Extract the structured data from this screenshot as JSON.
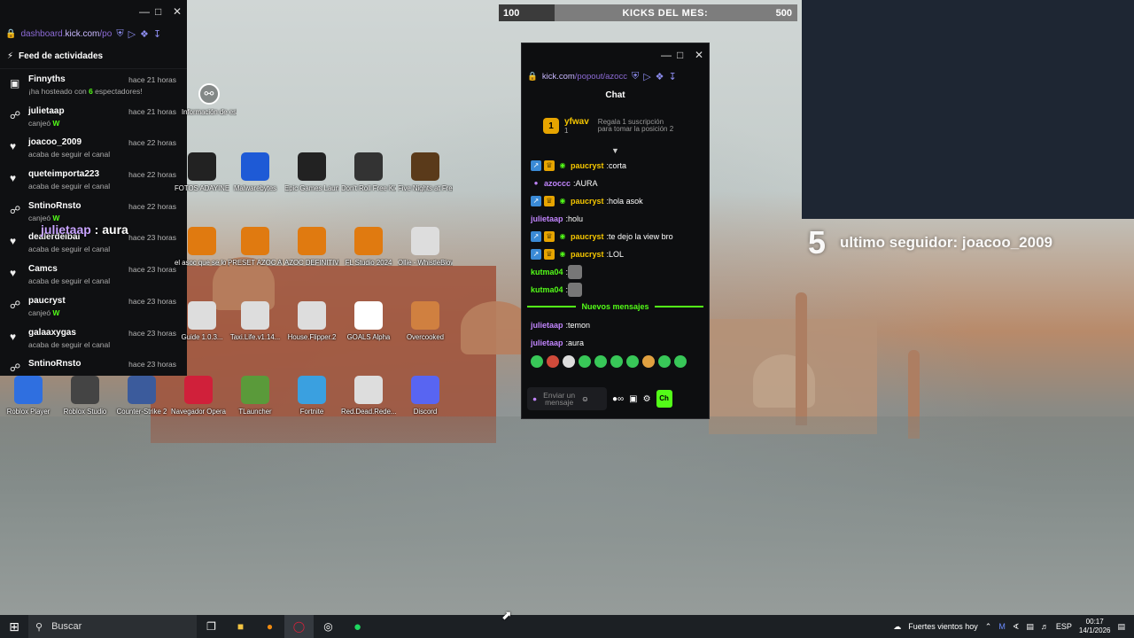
{
  "feed": {
    "url_prefix": "dashboard.",
    "url_domain": "kick.com",
    "url_path": "/po",
    "header": "Feed de actividades",
    "items": [
      {
        "icon": "stream-icon",
        "name": "Finnyths",
        "time": "hace 21 horas",
        "desc_pre": "¡ha hosteado con ",
        "desc_num": "6",
        "desc_post": " espectadores!"
      },
      {
        "icon": "share-icon",
        "name": "julietaap",
        "time": "hace 21 horas",
        "desc_pre": "canjeó ",
        "desc_num": "W",
        "desc_post": ""
      },
      {
        "icon": "heart-icon",
        "name": "joacoo_2009",
        "time": "hace 22 horas",
        "desc_pre": "acaba de seguir el canal",
        "desc_num": "",
        "desc_post": ""
      },
      {
        "icon": "heart-icon",
        "name": "queteimporta223",
        "time": "hace 22 horas",
        "desc_pre": "acaba de seguir el canal",
        "desc_num": "",
        "desc_post": ""
      },
      {
        "icon": "share-icon",
        "name": "SntinoRnsto",
        "time": "hace 22 horas",
        "desc_pre": "canjeó ",
        "desc_num": "W",
        "desc_post": ""
      },
      {
        "icon": "heart-icon",
        "name": "dealerdeibai",
        "time": "hace 23 horas",
        "desc_pre": "acaba de seguir el canal",
        "desc_num": "",
        "desc_post": ""
      },
      {
        "icon": "heart-icon",
        "name": "Camcs",
        "time": "hace 23 horas",
        "desc_pre": "acaba de seguir el canal",
        "desc_num": "",
        "desc_post": ""
      },
      {
        "icon": "share-icon",
        "name": "paucryst",
        "time": "hace 23 horas",
        "desc_pre": "canjeó ",
        "desc_num": "W",
        "desc_post": ""
      },
      {
        "icon": "heart-icon",
        "name": "galaaxygas",
        "time": "hace 23 horas",
        "desc_pre": "acaba de seguir el canal",
        "desc_num": "",
        "desc_post": ""
      },
      {
        "icon": "share-icon",
        "name": "SntinoRnsto",
        "time": "hace 23 horas",
        "desc_pre": "",
        "desc_num": "",
        "desc_post": ""
      }
    ]
  },
  "overlay_chat": {
    "user": "julietaap",
    "sep": " : ",
    "text": "aura"
  },
  "kicks": {
    "start": "100",
    "label": "KICKS DEL MES:",
    "goal": "500",
    "progress": 0
  },
  "chat": {
    "url_domain": "kick.com",
    "url_path": "/popout/azocc",
    "title": "Chat",
    "sub_card": {
      "rank": "1",
      "name": "yfwav",
      "count": "1",
      "text": "Regala 1 suscripción para tomar la posición 2"
    },
    "messages": [
      {
        "badges": true,
        "user": "paucryst",
        "color": "#f6c700",
        "text": "corta"
      },
      {
        "badges": false,
        "mic": true,
        "user": "azoccc",
        "color": "#c084fc",
        "text": "AURA"
      },
      {
        "badges": true,
        "user": "paucryst",
        "color": "#f6c700",
        "text": "hola asok"
      },
      {
        "badges": false,
        "user": "julietaap",
        "color": "#c084fc",
        "text": "holu"
      },
      {
        "badges": true,
        "user": "paucryst",
        "color": "#f6c700",
        "text": "te dejo la view bro"
      },
      {
        "badges": true,
        "user": "paucryst",
        "color": "#f6c700",
        "text": "LOL"
      },
      {
        "badges": false,
        "user": "kutma04",
        "color": "#53fc18",
        "text": "",
        "emote": true
      },
      {
        "badges": false,
        "user": "kutma04",
        "color": "#53fc18",
        "text": "",
        "emote": true
      }
    ],
    "new_messages_label": "Nuevos mensajes",
    "new_messages": [
      {
        "user": "julietaap",
        "color": "#c084fc",
        "text": "temon"
      },
      {
        "user": "julietaap",
        "color": "#c084fc",
        "text": "aura"
      }
    ],
    "input_placeholder": "Enviar un mensaje",
    "send_label": "Ch"
  },
  "webcam": {
    "label": ""
  },
  "follower": {
    "num": "5",
    "text": "ultimo seguidor: joacoo_2009"
  },
  "desktop": {
    "help_label": "Información de esta ima...",
    "icons": [
      {
        "label": "FOTOS ADAYINE",
        "color": "#222"
      },
      {
        "label": "Malwarebytes",
        "color": "#1e5ad6"
      },
      {
        "label": "Epic Games Launcher",
        "color": "#222"
      },
      {
        "label": "Don't Roll Free Kick Challenge",
        "color": "#333"
      },
      {
        "label": "Five Nights at Freddy's",
        "color": "#5a3a1a"
      },
      {
        "label": "el asoc que se lo gane..",
        "color": "#e07a10"
      },
      {
        "label": "PRESET AZOC AHORA SI",
        "color": "#e07a10"
      },
      {
        "label": "AZOC DEFINITIVO",
        "color": "#e07a10"
      },
      {
        "label": "FL Studio 2024",
        "color": "#e07a10"
      },
      {
        "label": "Ollie - WhistleBlower",
        "color": "#ddd"
      },
      {
        "label": "Guide 1.0.3...",
        "color": "#ddd"
      },
      {
        "label": "Taxi.Life.v1.14...",
        "color": "#ddd"
      },
      {
        "label": "House.Flipper.2",
        "color": "#ddd"
      },
      {
        "label": "GOALS Alpha",
        "color": "#fff"
      },
      {
        "label": "Overcooked",
        "color": "#d08040"
      },
      {
        "label": "Roblox Player",
        "color": "#2f6fe0"
      },
      {
        "label": "Roblox Studio",
        "color": "#444"
      },
      {
        "label": "Counter-Strike 2",
        "color": "#3b5b9c"
      },
      {
        "label": "Navegador Opera GX",
        "color": "#d0203a"
      },
      {
        "label": "TLauncher",
        "color": "#5a9a3a"
      },
      {
        "label": "Fortnite",
        "color": "#3aa0e0"
      },
      {
        "label": "Red.Dead.Rede...",
        "color": "#ddd"
      },
      {
        "label": "Discord",
        "color": "#5865f2"
      }
    ]
  },
  "taskbar": {
    "search_placeholder": "Buscar",
    "weather": "Fuertes vientos hoy",
    "lang": "ESP",
    "time": "00:17",
    "date": "14/1/2026"
  }
}
